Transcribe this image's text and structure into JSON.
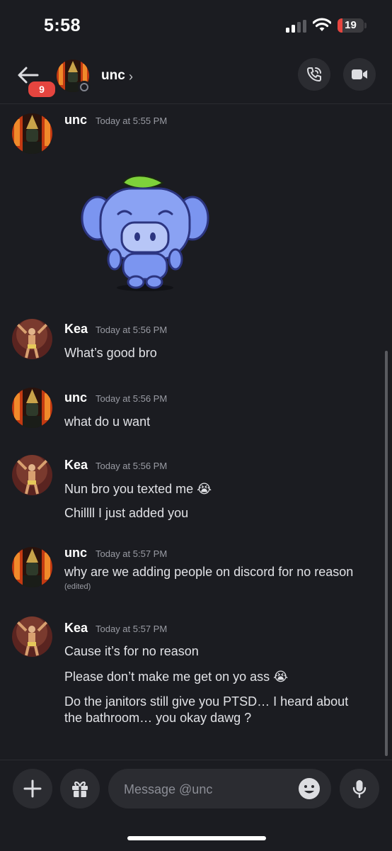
{
  "status_bar": {
    "time": "5:58",
    "battery": "19",
    "battery_level": 0.19
  },
  "header": {
    "badge": "9",
    "name": "unc",
    "chevron": "›"
  },
  "messages": [
    {
      "user": "unc",
      "timestamp": "Today at 5:55 PM",
      "lines": [],
      "sticker": "wumpus-sticker"
    },
    {
      "user": "Kea",
      "timestamp": "Today at 5:56 PM",
      "lines": [
        "What’s good bro"
      ]
    },
    {
      "user": "unc",
      "timestamp": "Today at 5:56 PM",
      "lines": [
        "what do u want"
      ]
    },
    {
      "user": "Kea",
      "timestamp": "Today at 5:56 PM",
      "lines": [
        "Nun bro you texted me 😭",
        "Chillll I just added you"
      ]
    },
    {
      "user": "unc",
      "timestamp": "Today at 5:57 PM",
      "lines": [
        "why are we adding people on discord for no reason"
      ],
      "edited": "(edited)"
    },
    {
      "user": "Kea",
      "timestamp": "Today at 5:57 PM",
      "lines": [
        "Cause it’s for no reason",
        "Please don’t make me get on yo ass 😭",
        "Do the janitors still give you PTSD… I heard about",
        "the bathroom… you okay dawg ?"
      ]
    }
  ],
  "composer": {
    "placeholder": "Message @unc"
  },
  "colors": {
    "background": "#1b1c21",
    "surface": "#2b2c31",
    "badge": "#e5453f",
    "wumpus": "#7b95f0",
    "leaf": "#7ed13a"
  },
  "icons": [
    "back-arrow-icon",
    "phone-call-icon",
    "video-camera-icon",
    "plus-icon",
    "gift-icon",
    "emoji-icon",
    "microphone-icon"
  ]
}
